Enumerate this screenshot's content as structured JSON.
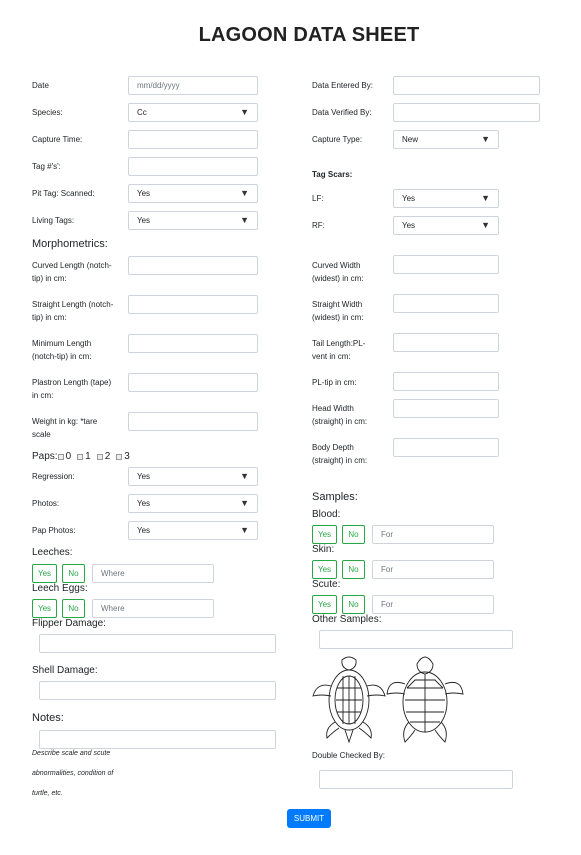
{
  "title": "LAGOON DATA SHEET",
  "left": {
    "date_label": "Date",
    "date_placeholder": "mm/dd/yyyy",
    "species_label": "Species:",
    "species_value": "Cc",
    "capture_time_label": "Capture Time:",
    "tag_label": "Tag #'s':",
    "pit_label": "Pit Tag: Scanned:",
    "pit_value": "Yes",
    "living_label": "Living Tags:",
    "living_value": "Yes",
    "morph_title": "Morphometrics:",
    "curved_label_1": "Curved Length (notch-",
    "curved_label_2": "tip) in cm:",
    "straight_label_1": "Straight Length (notch-",
    "straight_label_2": "tip) in cm:",
    "min_label_1": "Minimum Length",
    "min_label_2": "(notch-tip) in cm:",
    "plastron_label_1": "Plastron Length (tape)",
    "plastron_label_2": "in cm:",
    "weight_label_1": "Weight in kg: *tare",
    "weight_label_2": "scale",
    "paps_label": "Paps:",
    "paps_options": [
      "0",
      "1",
      "2",
      "3"
    ],
    "regression_label": "Regression:",
    "regression_value": "Yes",
    "photos_label": "Photos:",
    "photos_value": "Yes",
    "pap_photos_label": "Pap Photos:",
    "pap_photos_value": "Yes",
    "leeches_label": "Leeches:",
    "leech_eggs_label": "Leech Eggs:",
    "yes": "Yes",
    "no": "No",
    "where_placeholder": "Where",
    "flipper_label": "Flipper Damage:",
    "shell_label": "Shell Damage:",
    "notes_label": "Notes:",
    "notes_desc_1": "Describe scale and scute",
    "notes_desc_2": "abnormalities, condition of",
    "notes_desc_3": "turtle, etc."
  },
  "right": {
    "entered_label": "Data Entered By:",
    "verified_label": "Data Verified By:",
    "capture_type_label": "Capture Type:",
    "capture_type_value": "New",
    "tag_scars_label": "Tag Scars:",
    "lf_label": "LF:",
    "lf_value": "Yes",
    "rf_label": "RF:",
    "rf_value": "Yes",
    "cw_label_1": "Curved Width",
    "cw_label_2": "(widest) in cm:",
    "sw_label_1": "Straight Width",
    "sw_label_2": "(widest) in cm:",
    "tail_label_1": "Tail Length:PL-",
    "tail_label_2": "vent in cm:",
    "pltip_label": "PL-tip in cm:",
    "head_label_1": "Head Width",
    "head_label_2": "(straight) in cm:",
    "depth_label_1": "Body Depth",
    "depth_label_2": "(straight) in cm:",
    "samples_title": "Samples:",
    "blood_label": "Blood:",
    "skin_label": "Skin:",
    "scute_label": "Scute:",
    "for_placeholder": "For",
    "other_label": "Other Samples:",
    "double_label": "Double Checked By:"
  },
  "submit_label": "SUBMIT"
}
